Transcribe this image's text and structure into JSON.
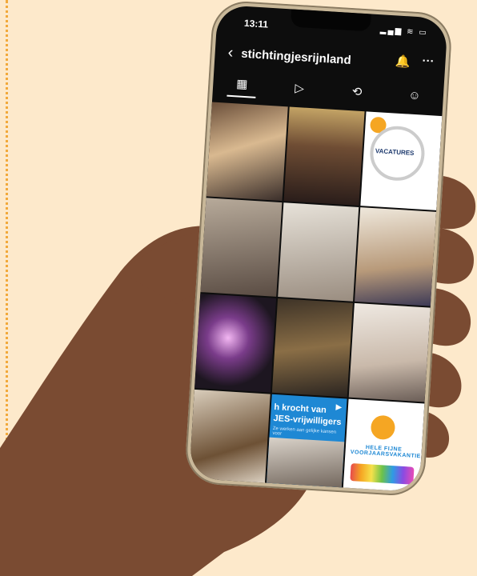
{
  "status_bar": {
    "time": "13:11",
    "icons": "▂▄▆ ≋ ▭"
  },
  "profile": {
    "back_icon": "‹",
    "username": "stichtingjesrijnland",
    "bell_icon": "🔔",
    "more_icon": "···"
  },
  "tabs": [
    {
      "name": "grid-icon",
      "glyph": "▦"
    },
    {
      "name": "reels-icon",
      "glyph": "▷"
    },
    {
      "name": "reposts-icon",
      "glyph": "⟲"
    },
    {
      "name": "tagged-icon",
      "glyph": "☺"
    }
  ],
  "posts": {
    "vacatures_title": "VACATURES",
    "banner_line1": "h krocht van",
    "banner_line2": "JES-vrijwilligers",
    "banner_sub": "Ze werken aan gelijke kansen voor",
    "volunteer_text": "HELE FIJNE VOORJAARSVAKANTIE!"
  },
  "colors": {
    "background": "#FDE9CB",
    "dotted_border": "#F2A93B",
    "brand_orange": "#F5A623",
    "brand_blue": "#1E88D4"
  }
}
